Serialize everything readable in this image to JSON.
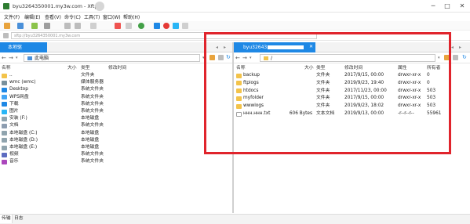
{
  "window": {
    "title": "byu3264350001.my3w.com - Xftp",
    "min": "─",
    "max": "□",
    "close": "✕"
  },
  "menu": [
    "文件(F)",
    "编辑(E)",
    "查看(V)",
    "命令(C)",
    "工具(T)",
    "窗口(W)",
    "帮助(H)"
  ],
  "address": {
    "value": "sftp://byu3264350001.my3w.com"
  },
  "local": {
    "tab_label": "本地驱",
    "path": "此电脑",
    "headers": {
      "name": "名称",
      "size": "大小",
      "type": "类型",
      "modified": "修改时间"
    },
    "rows": [
      {
        "name": "..",
        "size": "",
        "type": "文件夹",
        "icon": "folder-icon"
      },
      {
        "name": "wmc (wmc)",
        "size": "",
        "type": "媒体服务器",
        "icon": "network-icon"
      },
      {
        "name": "Desktop",
        "size": "",
        "type": "系统文件夹",
        "icon": "desktop-icon"
      },
      {
        "name": "WPS网盘",
        "size": "",
        "type": "系统文件夹",
        "icon": "cloud-icon"
      },
      {
        "name": "下载",
        "size": "",
        "type": "系统文件夹",
        "icon": "download-icon"
      },
      {
        "name": "图片",
        "size": "",
        "type": "系统文件夹",
        "icon": "picture-icon"
      },
      {
        "name": "安装 (F:)",
        "size": "",
        "type": "本地磁盘",
        "icon": "drive-icon"
      },
      {
        "name": "文档",
        "size": "",
        "type": "系统文件夹",
        "icon": "document-icon"
      },
      {
        "name": "本地磁盘 (C:)",
        "size": "",
        "type": "本地磁盘",
        "icon": "drive-icon"
      },
      {
        "name": "本地磁盘 (D:)",
        "size": "",
        "type": "本地磁盘",
        "icon": "drive-icon"
      },
      {
        "name": "本地磁盘 (E:)",
        "size": "",
        "type": "本地磁盘",
        "icon": "drive-icon"
      },
      {
        "name": "视频",
        "size": "",
        "type": "系统文件夹",
        "icon": "video-icon"
      },
      {
        "name": "音乐",
        "size": "",
        "type": "系统文件夹",
        "icon": "music-icon"
      }
    ]
  },
  "remote": {
    "tab_label": "byu32643",
    "path": "/",
    "headers": {
      "name": "名称",
      "size": "大小",
      "type": "类型",
      "modified": "修改时间",
      "attr": "属性",
      "owner": "所有者"
    },
    "rows": [
      {
        "name": "backup",
        "size": "",
        "type": "文件夹",
        "modified": "2017/9/15, 00:00",
        "attr": "drwxr-xr-x",
        "owner": "0",
        "icon": "folder-icon"
      },
      {
        "name": "ftplogs",
        "size": "",
        "type": "文件夹",
        "modified": "2019/9/23, 19:40",
        "attr": "drwxr-xr-x",
        "owner": "0",
        "icon": "folder-icon"
      },
      {
        "name": "htdocs",
        "size": "",
        "type": "文件夹",
        "modified": "2017/11/23, 00:00",
        "attr": "drwxr-xr-x",
        "owner": "503",
        "icon": "folder-icon"
      },
      {
        "name": "myfolder",
        "size": "",
        "type": "文件夹",
        "modified": "2017/9/15, 00:00",
        "attr": "drwxr-xr-x",
        "owner": "503",
        "icon": "folder-icon"
      },
      {
        "name": "wwwlogs",
        "size": "",
        "type": "文件夹",
        "modified": "2019/9/23, 18:02",
        "attr": "drwxr-xr-x",
        "owner": "503",
        "icon": "folder-icon"
      },
      {
        "name": "ннн.ннн.txt",
        "size": "606 Bytes",
        "type": "文本文档",
        "modified": "2019/9/13, 00:00",
        "attr": "-r--r--r--",
        "owner": "55961",
        "icon": "text-file-icon"
      }
    ]
  },
  "bottom_tabs": [
    "传输",
    "日志"
  ],
  "colors": {
    "accent": "#1e88e5",
    "highlight_box": "#e0242c",
    "folder": "#f3c34a"
  }
}
